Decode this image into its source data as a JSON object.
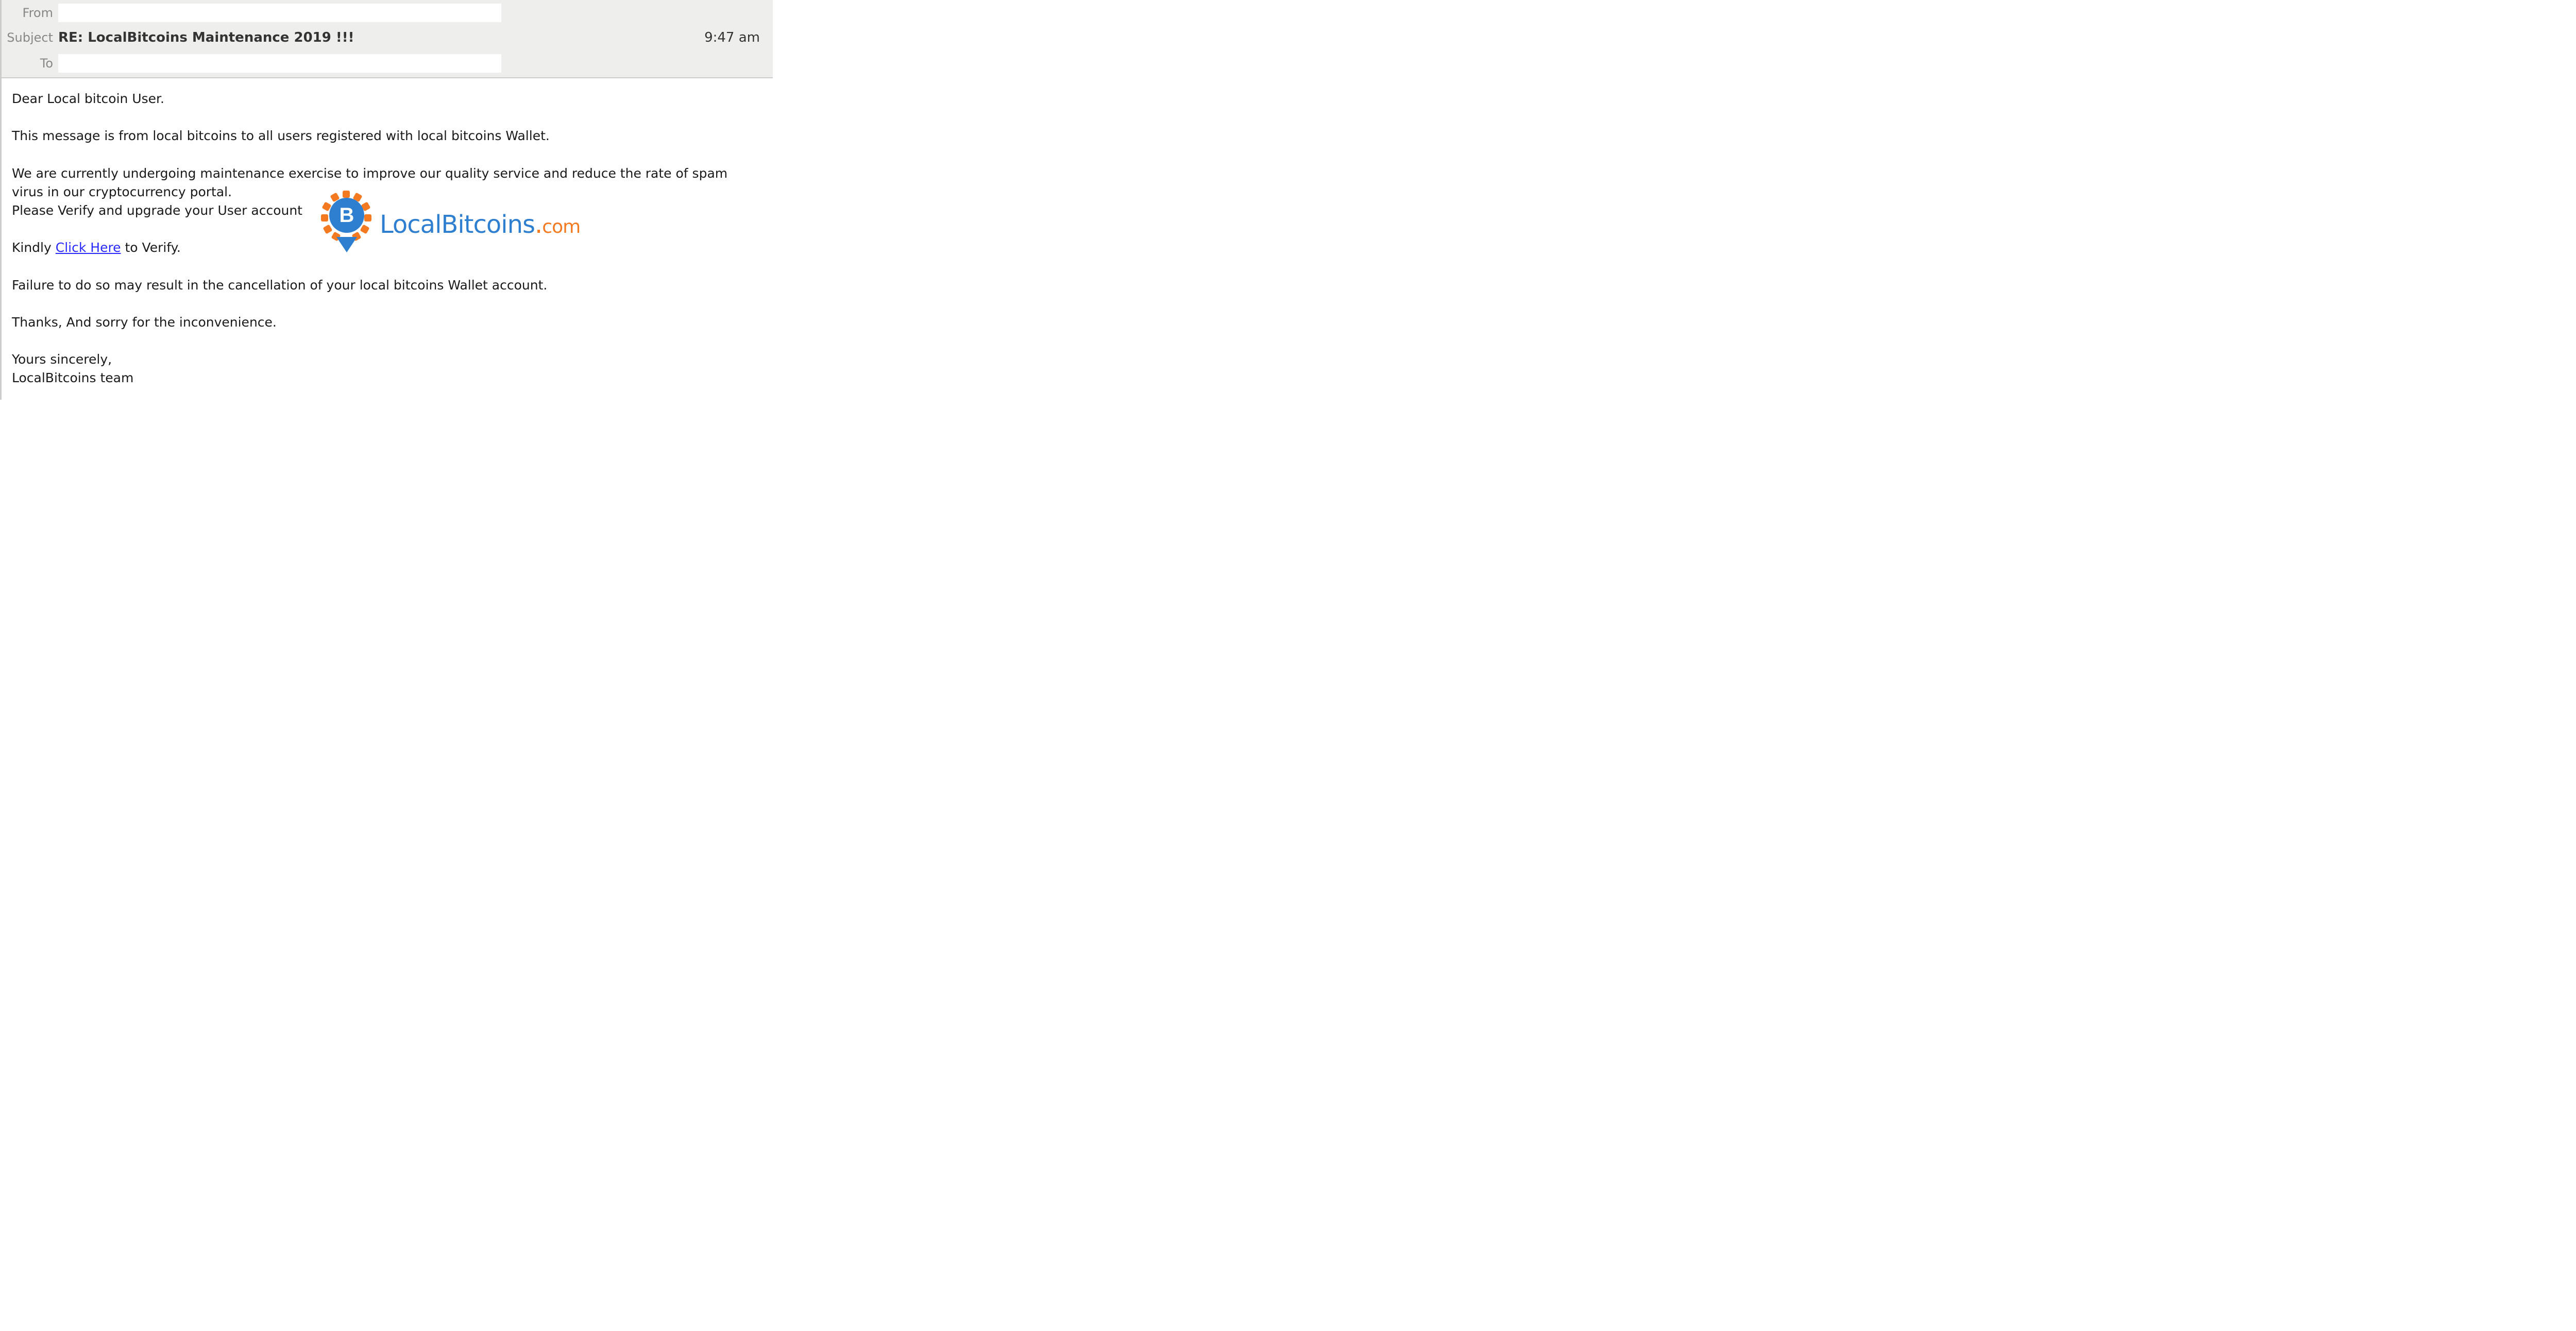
{
  "header": {
    "from_label": "From",
    "from_value": "",
    "subject_label": "Subject",
    "subject_value": "RE: LocalBitcoins Maintenance 2019 !!!",
    "to_label": "To",
    "to_value": "",
    "time": "9:47 am"
  },
  "body": {
    "greeting": "Dear Local bitcoin User.",
    "p1": "This message is from local bitcoins to all users registered with local bitcoins Wallet.",
    "p2a": "We are currently undergoing maintenance exercise to improve our quality service and reduce the rate of spam virus in our cryptocurrency portal.",
    "p2b": "Please Verify and upgrade your User account",
    "p3_prefix": "Kindly ",
    "p3_link": "Click Here",
    "p3_suffix": " to Verify.",
    "p4": "Failure to do so may result in the cancellation of your local bitcoins Wallet account.",
    "p5": "Thanks, And sorry for the inconvenience.",
    "signoff1": "Yours sincerely,",
    "signoff2": "LocalBitcoins team"
  },
  "logo": {
    "text_main": "LocalBitcoins",
    "text_dot": ".",
    "text_suffix": "com",
    "icon_letter": "B"
  }
}
